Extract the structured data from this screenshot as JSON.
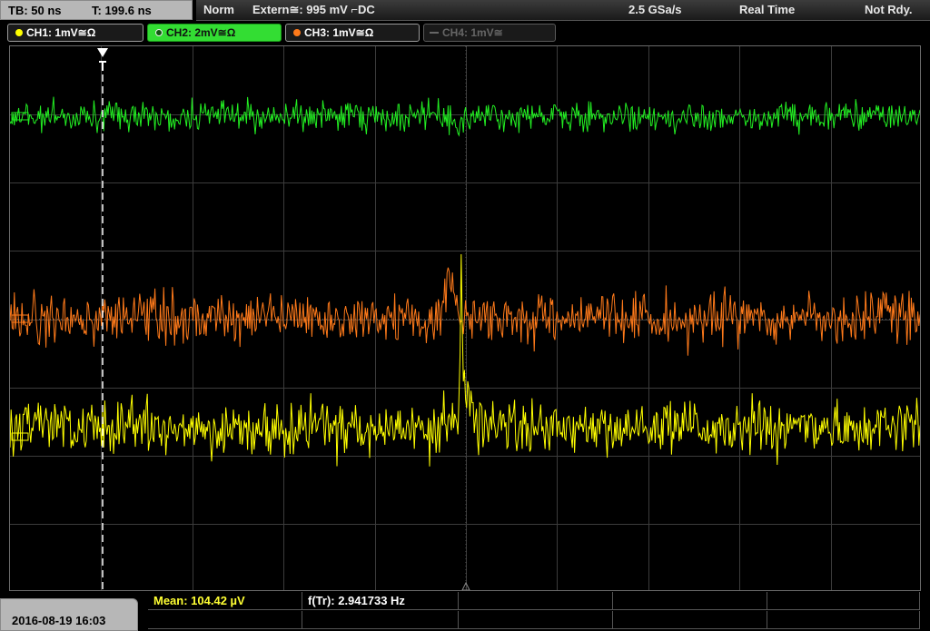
{
  "topbar": {
    "timebase": "TB: 50 ns",
    "trigger_pos": "T: 199.6 ns",
    "mode": "Norm",
    "trigger_source": "Extern≅: 995 mV ⌐DC",
    "sample_rate": "2.5 GSa/s",
    "acq_mode": "Real Time",
    "status": "Not Rdy."
  },
  "channels": [
    {
      "label": "CH1: 1mV≅Ω",
      "color": "#ffff00"
    },
    {
      "label": "CH2: 2mV≅Ω",
      "color": "#33ee33"
    },
    {
      "label": "CH3: 1mV≅Ω",
      "color": "#ff7a1a"
    },
    {
      "label": "CH4: 1mV≅",
      "color": "#777777"
    }
  ],
  "bottom": {
    "datetime": "2016-08-19 16:03",
    "mean": "Mean: 104.42 µV",
    "freq": "f(Tr): 2.941733 Hz"
  },
  "colors": {
    "ch1": "#ffff00",
    "ch2": "#22ee22",
    "ch3": "#ff7a1a",
    "grid": "#3c3c3c",
    "trigger_line": "#ffffff"
  }
}
